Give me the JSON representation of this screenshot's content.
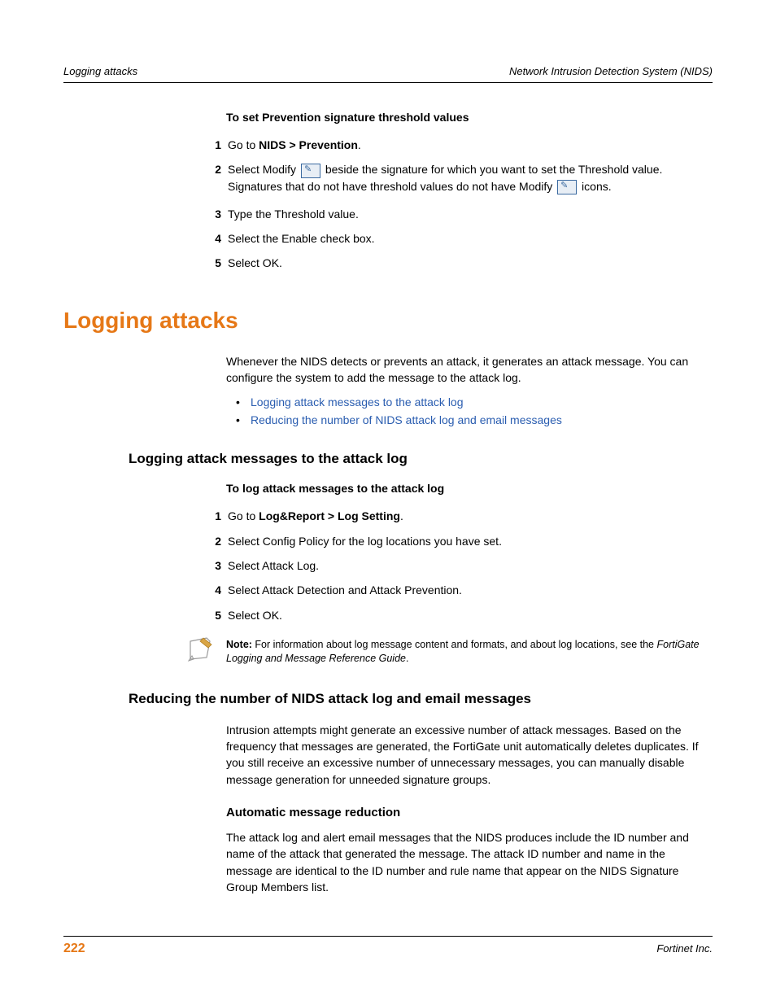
{
  "header": {
    "left": "Logging attacks",
    "right": "Network Intrusion Detection System (NIDS)"
  },
  "proc1": {
    "title": "To set Prevention signature threshold values",
    "s1_pre": "Go to ",
    "s1_b": "NIDS > Prevention",
    "s1_post": ".",
    "s2_a": "Select Modify ",
    "s2_b": " beside the signature for which you want to set the Threshold value. Signatures that do not have threshold values do not have Modify ",
    "s2_c": " icons.",
    "s3": "Type the Threshold value.",
    "s4": "Select the Enable check box.",
    "s5": "Select OK."
  },
  "section_title": "Logging attacks",
  "intro": "Whenever the NIDS detects or prevents an attack, it generates an attack message. You can configure the system to add the message to the attack log.",
  "links": {
    "l1": "Logging attack messages to the attack log",
    "l2": "Reducing the number of NIDS attack log and email messages"
  },
  "sub1_title": "Logging attack messages to the attack log",
  "proc2": {
    "title": "To log attack messages to the attack log",
    "s1_pre": "Go to ",
    "s1_b": "Log&Report > Log Setting",
    "s1_post": ".",
    "s2": "Select Config Policy for the log locations you have set.",
    "s3": "Select Attack Log.",
    "s4": "Select Attack Detection and Attack Prevention.",
    "s5": "Select OK."
  },
  "note": {
    "label": "Note:",
    "text": " For information about log message content and formats, and about log locations, see the ",
    "ref": "FortiGate Logging and Message Reference Guide",
    "post": "."
  },
  "sub2_title": "Reducing the number of NIDS attack log and email messages",
  "sub2_para": "Intrusion attempts might generate an excessive number of attack messages. Based on the frequency that messages are generated, the FortiGate unit automatically deletes duplicates. If you still receive an excessive number of unnecessary messages, you can manually disable message generation for unneeded signature groups.",
  "sub3_title": "Automatic message reduction",
  "sub3_para": "The attack log and alert email messages that the NIDS produces include the ID number and name of the attack that generated the message. The attack ID number and name in the message are identical to the ID number and rule name that appear on the NIDS Signature Group Members list.",
  "footer": {
    "page": "222",
    "right": "Fortinet Inc."
  },
  "nums": {
    "n1": "1",
    "n2": "2",
    "n3": "3",
    "n4": "4",
    "n5": "5"
  }
}
